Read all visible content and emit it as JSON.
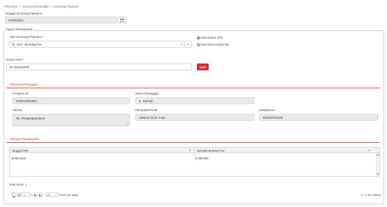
{
  "breadcrumb": {
    "items": [
      "FINANCE",
      "Account Receivable",
      "Incoming Payment"
    ],
    "separator": ">"
  },
  "header": {
    "date_label": "Tanggal Incoming Payment",
    "date_value": "07/05/2021"
  },
  "tujuan": {
    "title": "Tujuan Pembayaran",
    "tipe_label": "Tipe Incoming Payment",
    "tipe_value": "Unit - Booking Fee",
    "radio_spk": "Input Nomor SPK",
    "radio_sales": "Input Nama Salesman",
    "nomor_spk_label": "Nomor SPK",
    "nomor_spk_value": "RI-19010087P",
    "cari_label": "Cari"
  },
  "pelanggan": {
    "title": "Informasi Pelanggan",
    "prospect_label": "Prospect ID",
    "prospect_value": "P1901090029S",
    "nama_label": "Nama Pelanggan",
    "nama_value": "H. Dulmuil",
    "alamat_label": "Alamat",
    "alamat_value": "Kp. Pengangsaranpin",
    "kabupaten_label": "Kabupaten/Kota",
    "kabupaten_value": "Jakarta Timur, Kota",
    "handphone_label": "Handphone",
    "handphone_value": "081290100126"
  },
  "pembayaran": {
    "title": "Infomasi Pembayaran",
    "columns": [
      "Tanggal SPK",
      "Nominal Booking Fee"
    ],
    "rows": [
      [
        "26-06-2019",
        "5.000.000"
      ]
    ],
    "total_items": "Total Items: 1"
  },
  "pager": {
    "page": "1",
    "of": "/1",
    "page_size": "10",
    "items_per_page": "items per page",
    "range": "1 - 1 of 1 items"
  },
  "colors": {
    "accent_red": "#d32f2f",
    "section_line": "#e24b3b"
  }
}
